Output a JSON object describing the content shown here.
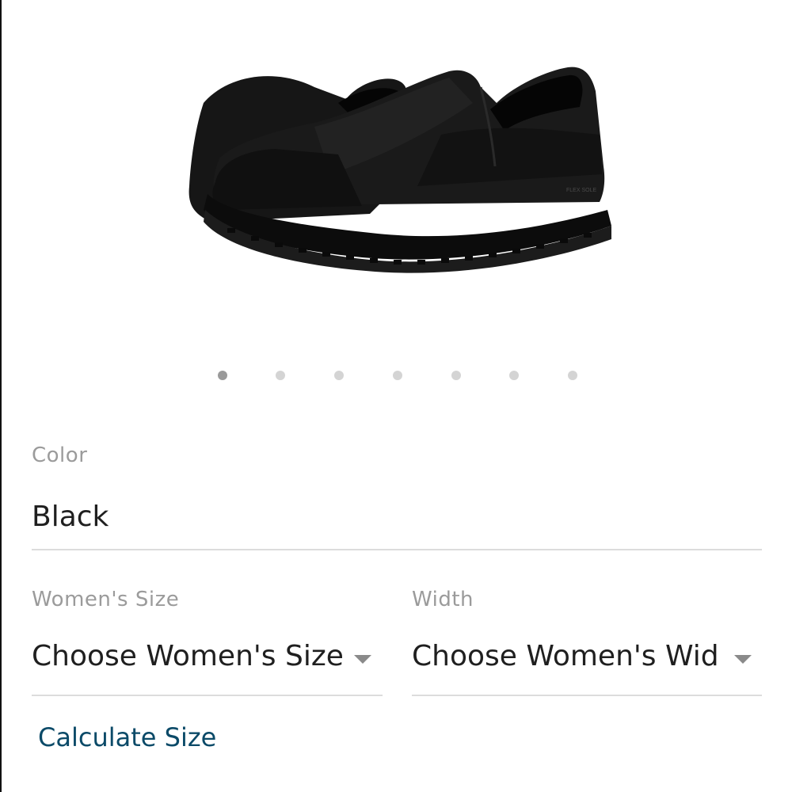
{
  "product": {
    "image_alt": "black slip-on shoes",
    "sole_text": "FLEX SOLE",
    "image_pager": {
      "count": 7,
      "active_index": 0
    }
  },
  "color": {
    "label": "Color",
    "value": "Black"
  },
  "size": {
    "label": "Women's Size",
    "value": "Choose Women's Size"
  },
  "width": {
    "label": "Width",
    "value": "Choose Women's Wid"
  },
  "calculate_link": "Calculate Size",
  "colors": {
    "label_gray": "#9b9b9b",
    "value_dark": "#1f1f1f",
    "link_blue": "#0b4a68",
    "divider": "#dcdcdc"
  }
}
